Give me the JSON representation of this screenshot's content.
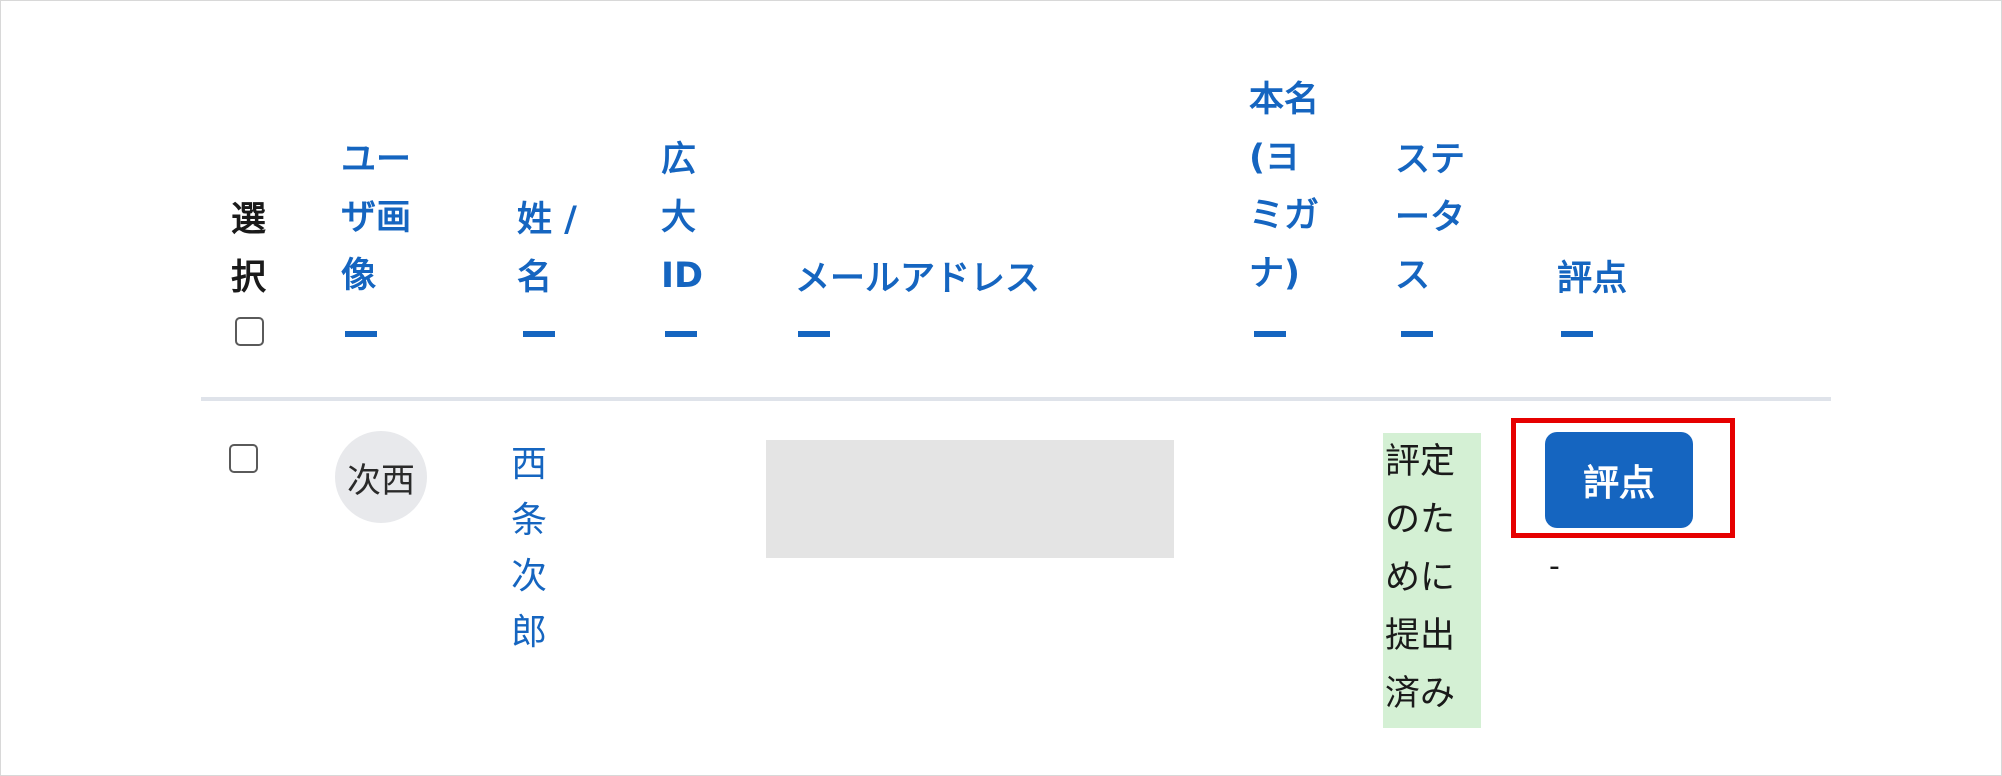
{
  "table": {
    "headers": {
      "select": "選択",
      "user_image": "ユーザ画像",
      "name": "姓 / 名",
      "hirodai_id": "広大ID",
      "email": "メールアドレス",
      "real_name": "本名(ヨミガナ)",
      "status": "ステータス",
      "grade": "評点"
    },
    "rows": [
      {
        "avatar_initials": "次西",
        "name": "西条次郎",
        "status": "評定のために提出済み",
        "grade_button": "評点",
        "grade_value": "-"
      }
    ]
  },
  "colors": {
    "link": "#1565c0",
    "button": "#1565c0",
    "status_bg": "#d4f0d4",
    "highlight": "#e60000"
  }
}
